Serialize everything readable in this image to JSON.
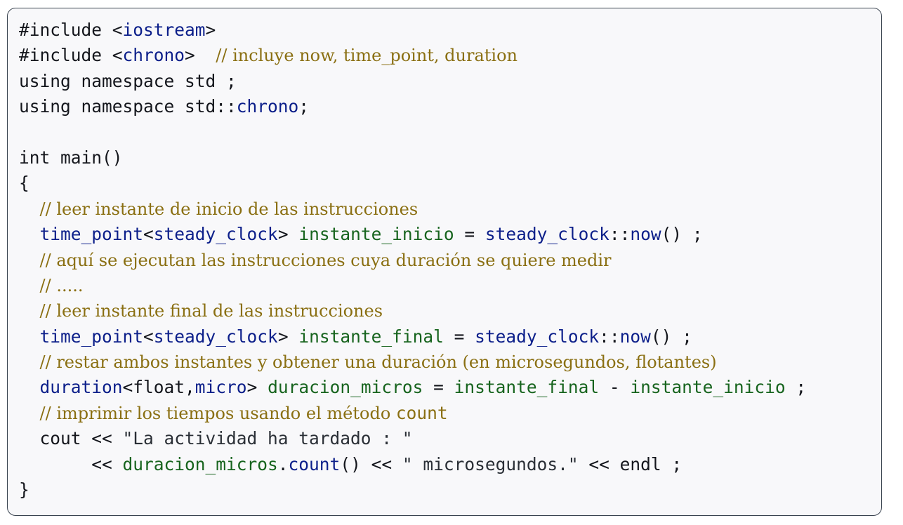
{
  "code_lines": [
    [
      {
        "t": "#include <",
        "c": "kw"
      },
      {
        "t": "iostream",
        "c": "blue"
      },
      {
        "t": ">",
        "c": "kw"
      }
    ],
    [
      {
        "t": "#include <",
        "c": "kw"
      },
      {
        "t": "chrono",
        "c": "blue"
      },
      {
        "t": ">  ",
        "c": "kw"
      },
      {
        "t": "// incluye now, time_point, duration",
        "c": "cm"
      }
    ],
    [
      {
        "t": "using namespace std ;",
        "c": "kw"
      }
    ],
    [
      {
        "t": "using namespace std::",
        "c": "kw"
      },
      {
        "t": "chrono",
        "c": "blue"
      },
      {
        "t": ";",
        "c": "kw"
      }
    ],
    [],
    [
      {
        "t": "int main()",
        "c": "kw"
      }
    ],
    [
      {
        "t": "{",
        "c": "kw"
      }
    ],
    [
      {
        "t": "  ",
        "c": "kw"
      },
      {
        "t": "// leer instante de inicio de las instrucciones",
        "c": "cm"
      }
    ],
    [
      {
        "t": "  ",
        "c": "kw"
      },
      {
        "t": "time_point",
        "c": "blue"
      },
      {
        "t": "<",
        "c": "kw"
      },
      {
        "t": "steady_clock",
        "c": "blue"
      },
      {
        "t": "> ",
        "c": "kw"
      },
      {
        "t": "instante_inicio",
        "c": "green"
      },
      {
        "t": " = ",
        "c": "kw"
      },
      {
        "t": "steady_clock",
        "c": "blue"
      },
      {
        "t": "::",
        "c": "kw"
      },
      {
        "t": "now",
        "c": "blue"
      },
      {
        "t": "() ;",
        "c": "kw"
      }
    ],
    [
      {
        "t": "  ",
        "c": "kw"
      },
      {
        "t": "// aquí se ejecutan las instrucciones cuya duración se quiere medir",
        "c": "cm"
      }
    ],
    [
      {
        "t": "  ",
        "c": "kw"
      },
      {
        "t": "// .....",
        "c": "cm"
      }
    ],
    [
      {
        "t": "  ",
        "c": "kw"
      },
      {
        "t": "// leer instante final de las instrucciones",
        "c": "cm"
      }
    ],
    [
      {
        "t": "  ",
        "c": "kw"
      },
      {
        "t": "time_point",
        "c": "blue"
      },
      {
        "t": "<",
        "c": "kw"
      },
      {
        "t": "steady_clock",
        "c": "blue"
      },
      {
        "t": "> ",
        "c": "kw"
      },
      {
        "t": "instante_final",
        "c": "green"
      },
      {
        "t": " = ",
        "c": "kw"
      },
      {
        "t": "steady_clock",
        "c": "blue"
      },
      {
        "t": "::",
        "c": "kw"
      },
      {
        "t": "now",
        "c": "blue"
      },
      {
        "t": "() ;",
        "c": "kw"
      }
    ],
    [
      {
        "t": "  ",
        "c": "kw"
      },
      {
        "t": "// restar ambos instantes y obtener una duración (en microsegundos, flotantes)",
        "c": "cm"
      }
    ],
    [
      {
        "t": "  ",
        "c": "kw"
      },
      {
        "t": "duration",
        "c": "blue"
      },
      {
        "t": "<float,",
        "c": "kw"
      },
      {
        "t": "micro",
        "c": "blue"
      },
      {
        "t": "> ",
        "c": "kw"
      },
      {
        "t": "duracion_micros",
        "c": "green"
      },
      {
        "t": " = ",
        "c": "kw"
      },
      {
        "t": "instante_final",
        "c": "green"
      },
      {
        "t": " - ",
        "c": "kw"
      },
      {
        "t": "instante_inicio",
        "c": "green"
      },
      {
        "t": " ;",
        "c": "kw"
      }
    ],
    [
      {
        "t": "  ",
        "c": "kw"
      },
      {
        "t": "// imprimir los tiempos usando el método ",
        "c": "cm"
      },
      {
        "t": "count",
        "c": "cmcode"
      }
    ],
    [
      {
        "t": "  cout << ",
        "c": "kw"
      },
      {
        "t": "\"La actividad ha tardado : \"",
        "c": "txt"
      }
    ],
    [
      {
        "t": "       << ",
        "c": "kw"
      },
      {
        "t": "duracion_micros",
        "c": "green"
      },
      {
        "t": ".",
        "c": "kw"
      },
      {
        "t": "count",
        "c": "blue"
      },
      {
        "t": "() << ",
        "c": "kw"
      },
      {
        "t": "\" microsegundos.\"",
        "c": "txt"
      },
      {
        "t": " << endl ;",
        "c": "kw"
      }
    ],
    [
      {
        "t": "}",
        "c": "kw"
      }
    ]
  ]
}
